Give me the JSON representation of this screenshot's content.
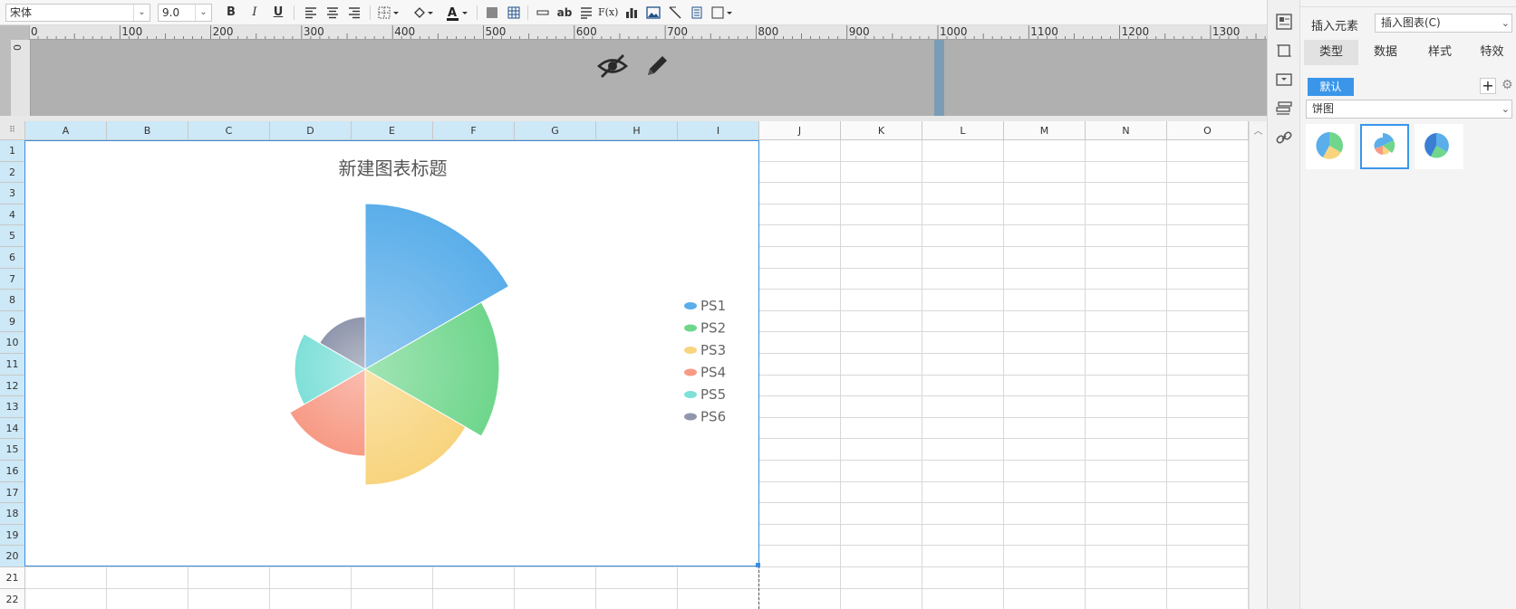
{
  "toolbar": {
    "font_name": "宋体",
    "font_size": "9.0",
    "bold_label": "B",
    "italic_label": "I",
    "underline_label": "U",
    "abbr_label": "ab",
    "formula_label": "F(x)"
  },
  "ruler": {
    "h_ticks": [
      "0",
      "100",
      "200",
      "300",
      "400",
      "500",
      "600",
      "700",
      "800",
      "900",
      "1000",
      "1100",
      "1200",
      "1300"
    ],
    "v_tick": "0"
  },
  "grid": {
    "columns": [
      "A",
      "B",
      "C",
      "D",
      "E",
      "F",
      "G",
      "H",
      "I",
      "J",
      "K",
      "L",
      "M",
      "N",
      "O"
    ],
    "rows": [
      "1",
      "2",
      "3",
      "4",
      "5",
      "6",
      "7",
      "8",
      "9",
      "10",
      "11",
      "12",
      "13",
      "14",
      "15",
      "16",
      "17",
      "18",
      "19",
      "20",
      "21",
      "22"
    ]
  },
  "chart_data": {
    "type": "pie",
    "variant": "rose",
    "title": "新建图表标题",
    "categories": [
      "PS1",
      "PS2",
      "PS3",
      "PS4",
      "PS5",
      "PS6"
    ],
    "values": [
      183,
      148,
      128,
      96,
      78,
      58
    ],
    "colors": [
      "#5aaeea",
      "#6fd68c",
      "#f8d47e",
      "#f79a85",
      "#7ee0d8",
      "#9096ac"
    ],
    "legend_position": "right"
  },
  "panel": {
    "insert_element_label": "插入元素",
    "insert_chart_value": "插入图表(C)",
    "tabs": [
      "类型",
      "数据",
      "样式",
      "特效"
    ],
    "default_label": "默认",
    "chart_kind": "饼图"
  }
}
